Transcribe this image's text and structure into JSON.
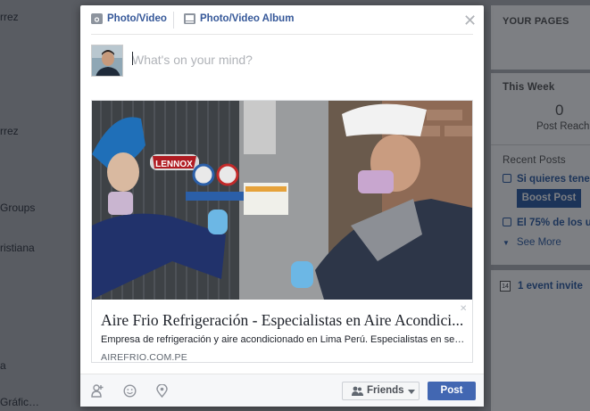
{
  "background": {
    "left_items": [
      "rrez",
      "rrez",
      "Groups",
      "ristiana",
      "a",
      "Gráfic…"
    ],
    "right_panel": {
      "your_pages": "YOUR PAGES",
      "this_week": "This Week",
      "post_reach_value": "0",
      "post_reach_label": "Post Reach",
      "recent_posts": "Recent Posts",
      "post_1": "Si quieres tener",
      "boost_post": "Boost Post",
      "post_2": "El 75% de los u",
      "see_more": "See More",
      "event_invite": "1 event invite",
      "calendar_day": "14"
    }
  },
  "composer": {
    "tabs": [
      {
        "label": "Photo/Video",
        "icon": "camera-icon"
      },
      {
        "label": "Photo/Video Album",
        "icon": "album-icon"
      }
    ],
    "placeholder": "What's on your mind?",
    "value": ""
  },
  "link_preview": {
    "title": "Aire Frio Refrigeración - Especialistas en Aire Acondici...",
    "description": "Empresa de refrigeración y aire acondicionado en Lima Perú. Especialistas en ser...",
    "domain": "AIREFRIO.COM.PE",
    "photo_brand": "LENNOX",
    "remove_icon": "close-icon"
  },
  "footer": {
    "icons": [
      "tag-friends-icon",
      "feeling-icon",
      "location-icon"
    ],
    "audience_label": "Friends",
    "post_label": "Post"
  },
  "colors": {
    "accent": "#4267b2",
    "link": "#365899",
    "overlay": "#595c62"
  }
}
